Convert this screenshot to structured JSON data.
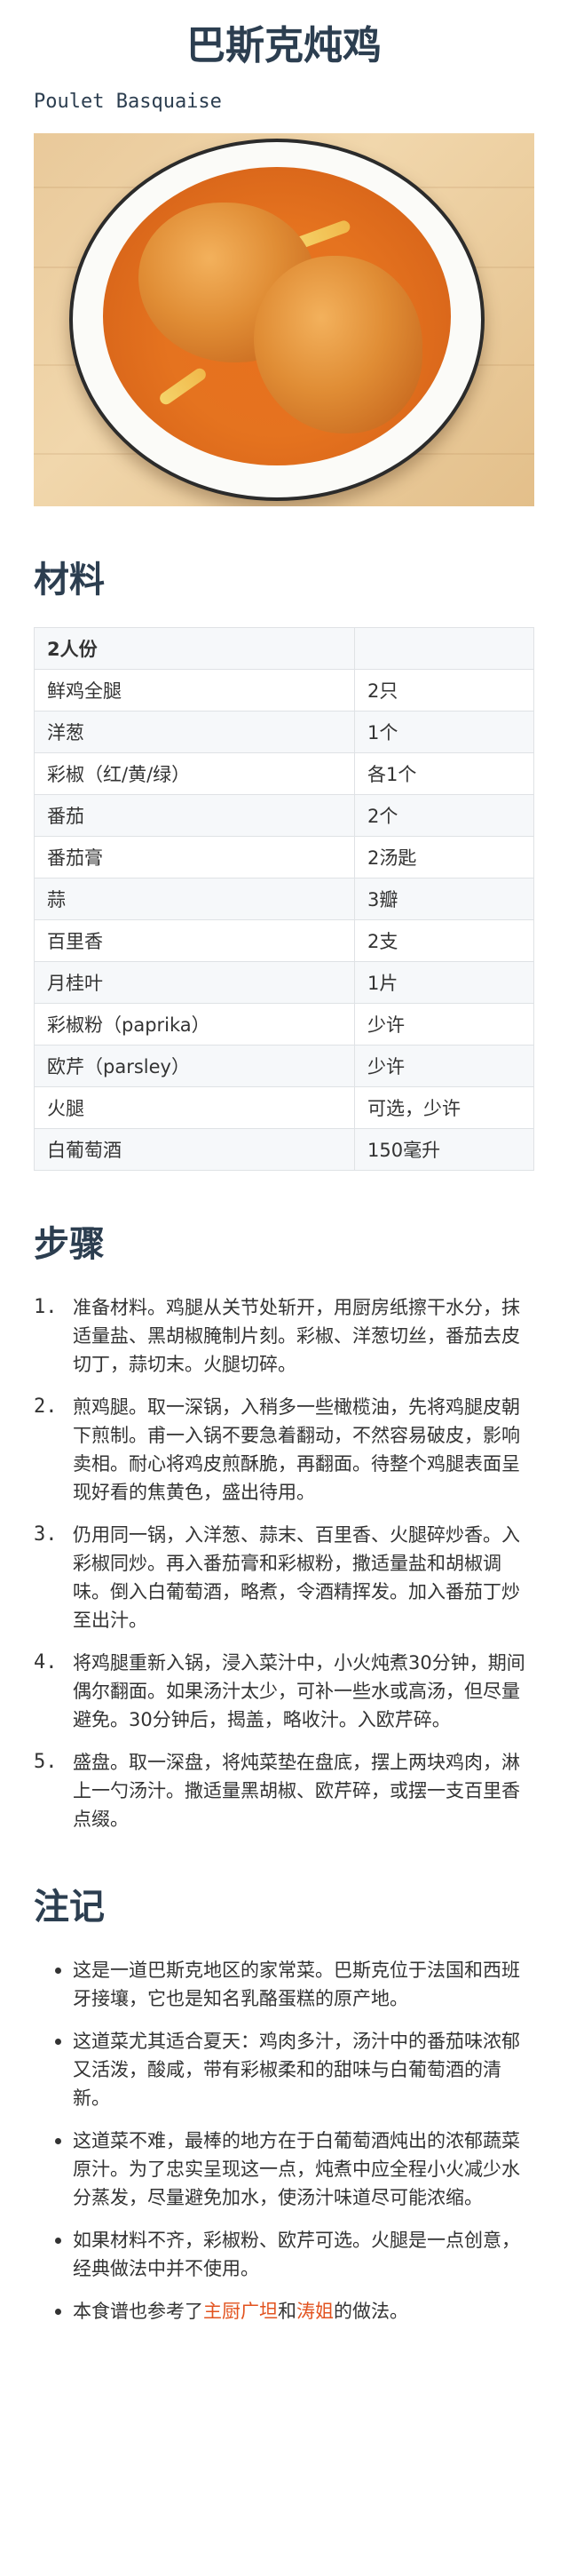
{
  "title": "巴斯克炖鸡",
  "subtitle": "Poulet Basquaise",
  "photo_description_icon": "dish-photo",
  "ingredients": {
    "heading": "材料",
    "header": [
      "2人份",
      ""
    ],
    "rows": [
      [
        "鲜鸡全腿",
        "2只"
      ],
      [
        "洋葱",
        "1个"
      ],
      [
        "彩椒（红/黄/绿）",
        "各1个"
      ],
      [
        "番茄",
        "2个"
      ],
      [
        "番茄膏",
        "2汤匙"
      ],
      [
        "蒜",
        "3瓣"
      ],
      [
        "百里香",
        "2支"
      ],
      [
        "月桂叶",
        "1片"
      ],
      [
        "彩椒粉（paprika）",
        "少许"
      ],
      [
        "欧芹（parsley）",
        "少许"
      ],
      [
        "火腿",
        "可选，少许"
      ],
      [
        "白葡萄酒",
        "150毫升"
      ]
    ]
  },
  "steps": {
    "heading": "步骤",
    "items": [
      {
        "num": "1.",
        "text": "准备材料。鸡腿从关节处斩开，用厨房纸擦干水分，抹适量盐、黑胡椒腌制片刻。彩椒、洋葱切丝，番茄去皮切丁，蒜切末。火腿切碎。"
      },
      {
        "num": "2.",
        "text": "煎鸡腿。取一深锅，入稍多一些橄榄油，先将鸡腿皮朝下煎制。甫一入锅不要急着翻动，不然容易破皮，影响卖相。耐心将鸡皮煎酥脆，再翻面。待整个鸡腿表面呈现好看的焦黄色，盛出待用。"
      },
      {
        "num": "3.",
        "text": "仍用同一锅，入洋葱、蒜末、百里香、火腿碎炒香。入彩椒同炒。再入番茄膏和彩椒粉，撒适量盐和胡椒调味。倒入白葡萄酒，略煮，令酒精挥发。加入番茄丁炒至出汁。"
      },
      {
        "num": "4.",
        "text": "将鸡腿重新入锅，浸入菜汁中，小火炖煮30分钟，期间偶尔翻面。如果汤汁太少，可补一些水或高汤，但尽量避免。30分钟后，揭盖，略收汁。入欧芹碎。"
      },
      {
        "num": "5.",
        "text": "盛盘。取一深盘，将炖菜垫在盘底，摆上两块鸡肉，淋上一勺汤汁。撒适量黑胡椒、欧芹碎，或摆一支百里香点缀。"
      }
    ]
  },
  "notes": {
    "heading": "注记",
    "items": [
      "这是一道巴斯克地区的家常菜。巴斯克位于法国和西班牙接壤，它也是知名乳酪蛋糕的原产地。",
      "这道菜尤其适合夏天：鸡肉多汁，汤汁中的番茄味浓郁又活泼，酸咸，带有彩椒柔和的甜味与白葡萄酒的清新。",
      "这道菜不难，最棒的地方在于白葡萄酒炖出的浓郁蔬菜原汁。为了忠实呈现这一点，炖煮中应全程小火减少水分蒸发，尽量避免加水，使汤汁味道尽可能浓缩。",
      "如果材料不齐，彩椒粉、欧芹可选。火腿是一点创意，经典做法中并不使用。"
    ],
    "credit": {
      "prefix": "本食谱也参考了",
      "link1": "主厨广坦",
      "middle": "和",
      "link2": "涛姐",
      "suffix": "的做法。"
    }
  },
  "colors": {
    "heading": "#2c3e50",
    "link": "#e2531f",
    "table_border": "#dfe2e5",
    "table_stripe": "#f6f8fa"
  }
}
